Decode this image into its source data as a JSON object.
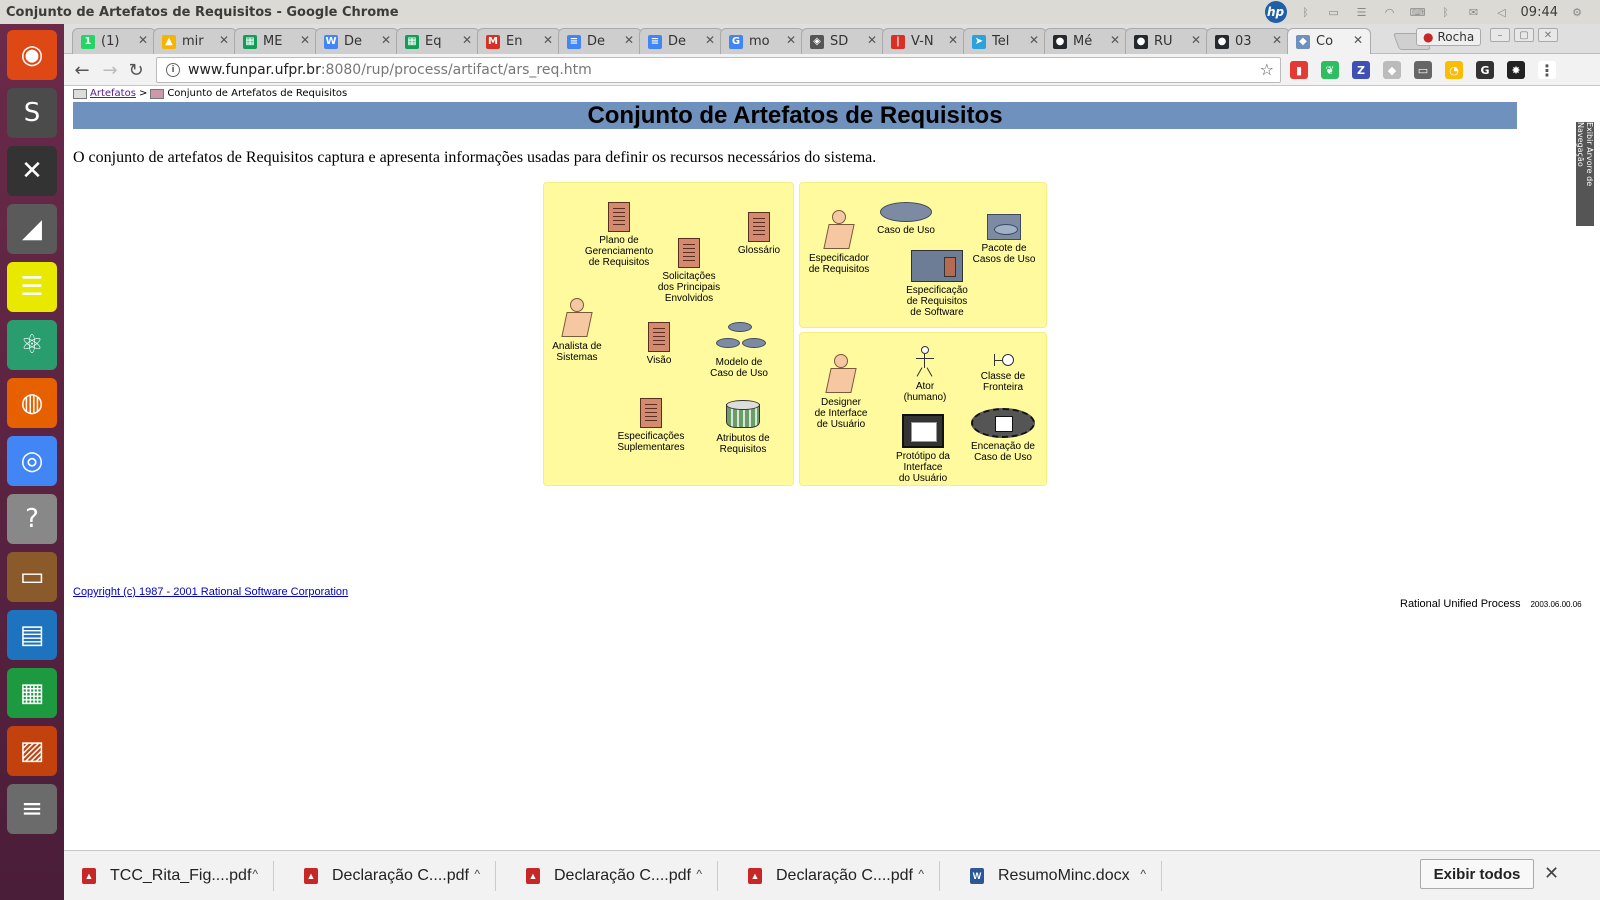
{
  "os": {
    "window_title": "Conjunto de Artefatos de Requisitos - Google Chrome",
    "clock": "09:44",
    "tray_user": "Rocha",
    "hp_logo": "hp"
  },
  "launcher": [
    {
      "name": "ubuntu-dash-icon",
      "color": "#dd4814",
      "glyph": "◉"
    },
    {
      "name": "sublime-text-icon",
      "color": "#4b4b4b",
      "glyph": "S"
    },
    {
      "name": "xournal-icon",
      "color": "#333333",
      "glyph": "✕"
    },
    {
      "name": "pdf-reader-icon",
      "color": "#5a5a5a",
      "glyph": "◢"
    },
    {
      "name": "notes-icon",
      "color": "#e8e800",
      "glyph": "☰"
    },
    {
      "name": "atom-icon",
      "color": "#2a9d6f",
      "glyph": "⚛"
    },
    {
      "name": "firefox-icon",
      "color": "#e66000",
      "glyph": "◍"
    },
    {
      "name": "chrome-icon",
      "color": "#4285f4",
      "glyph": "◎"
    },
    {
      "name": "help-icon",
      "color": "#888888",
      "glyph": "?"
    },
    {
      "name": "files-icon",
      "color": "#8b5a2b",
      "glyph": "▭"
    },
    {
      "name": "writer-icon",
      "color": "#1e73be",
      "glyph": "▤"
    },
    {
      "name": "calc-icon",
      "color": "#1d9a3f",
      "glyph": "▦"
    },
    {
      "name": "impress-icon",
      "color": "#c2410c",
      "glyph": "▨"
    },
    {
      "name": "app-stack-icon",
      "color": "#6b6b6b",
      "glyph": "≡"
    }
  ],
  "tabs": [
    {
      "label": "(1)",
      "fav": "1",
      "color": "#25d366"
    },
    {
      "label": "mir",
      "fav": "▲",
      "color": "#f4b400"
    },
    {
      "label": "ME",
      "fav": "▦",
      "color": "#0f9d58"
    },
    {
      "label": "De",
      "fav": "W",
      "color": "#4285f4"
    },
    {
      "label": "Eq",
      "fav": "▦",
      "color": "#0f9d58"
    },
    {
      "label": "En",
      "fav": "M",
      "color": "#d93025"
    },
    {
      "label": "De",
      "fav": "≡",
      "color": "#4285f4"
    },
    {
      "label": "De",
      "fav": "≡",
      "color": "#4285f4"
    },
    {
      "label": "mo",
      "fav": "G",
      "color": "#4285f4"
    },
    {
      "label": "SD",
      "fav": "◈",
      "color": "#555555"
    },
    {
      "label": "V-N",
      "fav": "|",
      "color": "#d93025"
    },
    {
      "label": "Tel",
      "fav": "➤",
      "color": "#2aa3dd"
    },
    {
      "label": "Mé",
      "fav": "●",
      "color": "#24292e"
    },
    {
      "label": "RU",
      "fav": "●",
      "color": "#24292e"
    },
    {
      "label": "03",
      "fav": "●",
      "color": "#24292e"
    },
    {
      "label": "Co",
      "fav": "◆",
      "color": "#6f91bd"
    }
  ],
  "address_bar": {
    "host": "www.funpar.ufpr.br",
    "path": ":8080/rup/process/artifact/ars_req.htm"
  },
  "extensions": [
    {
      "name": "bar-chart-extension-icon",
      "glyph": "▮",
      "color": "#e53935"
    },
    {
      "name": "evernote-extension-icon",
      "glyph": "❦",
      "color": "#2dbe60"
    },
    {
      "name": "zotero-extension-icon",
      "glyph": "Z",
      "color": "#3f51b5"
    },
    {
      "name": "pin-extension-icon",
      "glyph": "◆",
      "color": "#bbbbbb"
    },
    {
      "name": "cast-icon",
      "glyph": "▭",
      "color": "#666666"
    },
    {
      "name": "google-extension-icon",
      "glyph": "◔",
      "color": "#fbbc05"
    },
    {
      "name": "grammarly-extension-icon",
      "glyph": "G",
      "color": "#333333"
    },
    {
      "name": "octopus-extension-icon",
      "glyph": "✸",
      "color": "#222222"
    },
    {
      "name": "menu-icon",
      "glyph": "⋮",
      "color": "#ffffff"
    }
  ],
  "page": {
    "breadcrumb_link": "Artefatos",
    "breadcrumb_sep": ">",
    "breadcrumb_current": "Conjunto de Artefatos de Requisitos",
    "title": "Conjunto de Artefatos de Requisitos",
    "intro": "O conjunto de artefatos de Requisitos captura e apresenta informações usadas para definir os recursos necessários do sistema.",
    "side_tab": "Exibir Árvore de Navegação",
    "copyright": "Copyright  (c) 1987 - 2001 Rational Software Corporation",
    "rup_label": "Rational Unified Process",
    "rup_version": "2003.06.00.06"
  },
  "diagram": {
    "plano": "Plano de\nGerenciamento\nde Requisitos",
    "glossario": "Glossário",
    "solicitacoes": "Solicitações\ndos Principais\nEnvolvidos",
    "analista": "Analista de\nSistemas",
    "visao": "Visão",
    "modelo": "Modelo de\nCaso de Uso",
    "especificacoes_supl": "Especificações\nSuplementares",
    "atributos": "Atributos de\nRequisitos",
    "especificador": "Especificador\nde Requisitos",
    "caso_de_uso": "Caso de Uso",
    "pacote": "Pacote de\nCasos de Uso",
    "especificacao_sw": "Especificação\nde Requisitos\nde Software",
    "designer": "Designer\nde Interface\nde Usuário",
    "ator": "Ator\n(humano)",
    "classe_fronteira": "Classe de\nFronteira",
    "prototipo": "Protótipo da\nInterface\ndo Usuário",
    "encenacao": "Encenação de\nCaso de Uso"
  },
  "downloads": [
    {
      "name": "TCC_Rita_Fig....pdf",
      "type": "pdf"
    },
    {
      "name": "Declaração C....pdf",
      "type": "pdf"
    },
    {
      "name": "Declaração C....pdf",
      "type": "pdf"
    },
    {
      "name": "Declaração C....pdf",
      "type": "pdf"
    },
    {
      "name": "ResumoMinc.docx",
      "type": "docx"
    }
  ],
  "show_all": "Exibir todos"
}
